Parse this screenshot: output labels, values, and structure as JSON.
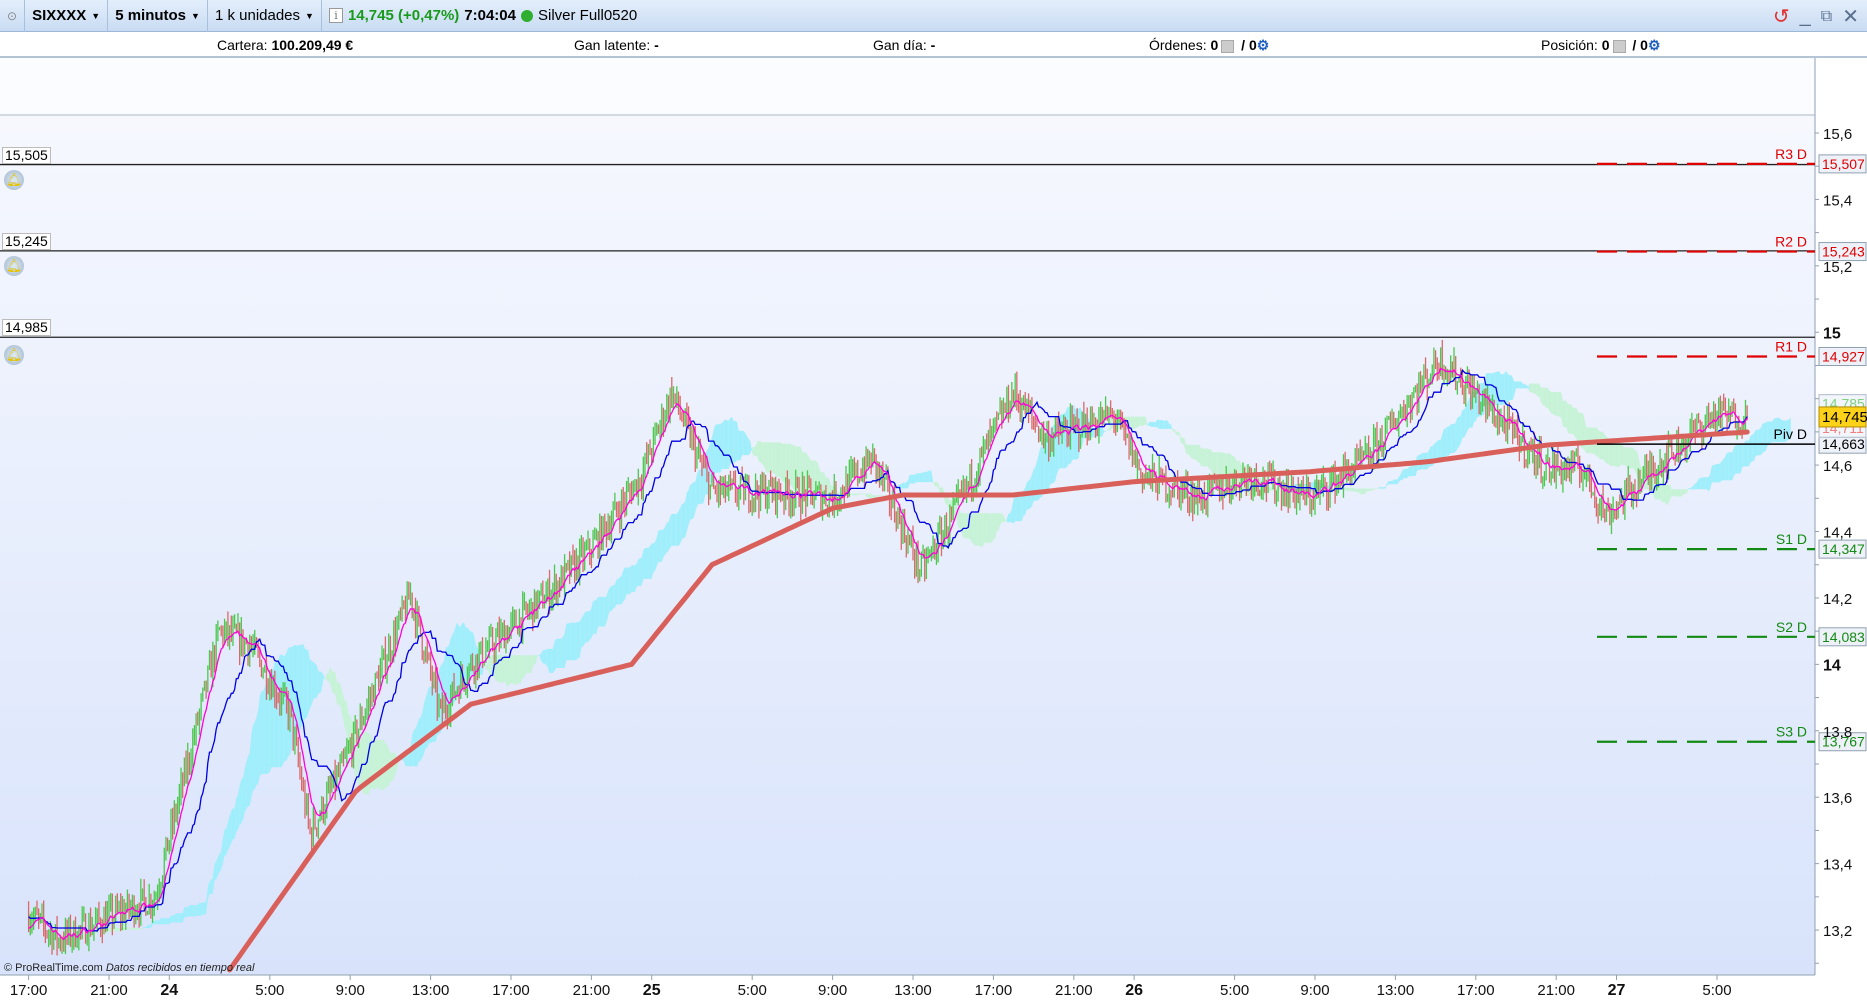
{
  "toolbar": {
    "instrument": "SIXXXX",
    "timeframe": "5 minutos",
    "units": "1 k unidades",
    "price": "14,745 (+0,47%)",
    "time": "7:04:04",
    "status_color": "#2fae2f",
    "feed": "Silver Full0520"
  },
  "infobar": {
    "cartera_label": "Cartera:",
    "cartera_value": "100.209,49 €",
    "gan_latente_label": "Gan latente:",
    "gan_latente_value": "-",
    "gan_dia_label": "Gan día:",
    "gan_dia_value": "-",
    "ordenes_label": "Órdenes:",
    "ordenes_a": "0",
    "ordenes_b": "/ 0",
    "posicion_label": "Posición:",
    "posicion_a": "0",
    "posicion_b": "/ 0"
  },
  "alerts": [
    {
      "label": "15,505",
      "value": 15.505
    },
    {
      "label": "15,245",
      "value": 15.245
    },
    {
      "label": "14,985",
      "value": 14.985
    }
  ],
  "credit": {
    "brand": "© ProRealTime.com",
    "text": "Datos recibidos en tiempo real"
  },
  "chart_data": {
    "type": "candlestick",
    "ylim": [
      13.1,
      15.7
    ],
    "y_ticks": [
      {
        "v": 15.6,
        "t": "15,6"
      },
      {
        "v": 15.4,
        "t": "15,4"
      },
      {
        "v": 15.2,
        "t": "15,2"
      },
      {
        "v": 15,
        "t": "15",
        "bold": true
      },
      {
        "v": 14.8,
        "t": ""
      },
      {
        "v": 14.6,
        "t": "14,6"
      },
      {
        "v": 14.4,
        "t": "14,4"
      },
      {
        "v": 14.2,
        "t": "14,2"
      },
      {
        "v": 14,
        "t": "14",
        "bold": true
      },
      {
        "v": 13.8,
        "t": "13,8"
      },
      {
        "v": 13.6,
        "t": "13,6"
      },
      {
        "v": 13.4,
        "t": "13,4"
      },
      {
        "v": 13.2,
        "t": "13,2"
      }
    ],
    "x_ticks": [
      {
        "h": 0,
        "t": "17:00"
      },
      {
        "h": 4,
        "t": "21:00"
      },
      {
        "h": 7,
        "t": "24",
        "bold": true
      },
      {
        "h": 12,
        "t": "5:00"
      },
      {
        "h": 16,
        "t": "9:00"
      },
      {
        "h": 20,
        "t": "13:00"
      },
      {
        "h": 24,
        "t": "17:00"
      },
      {
        "h": 28,
        "t": "21:00"
      },
      {
        "h": 31,
        "t": "25",
        "bold": true
      },
      {
        "h": 36,
        "t": "5:00"
      },
      {
        "h": 40,
        "t": "9:00"
      },
      {
        "h": 44,
        "t": "13:00"
      },
      {
        "h": 48,
        "t": "17:00"
      },
      {
        "h": 52,
        "t": "21:00"
      },
      {
        "h": 55,
        "t": "26",
        "bold": true
      },
      {
        "h": 60,
        "t": "5:00"
      },
      {
        "h": 64,
        "t": "9:00"
      },
      {
        "h": 68,
        "t": "13:00"
      },
      {
        "h": 72,
        "t": "17:00"
      },
      {
        "h": 76,
        "t": "21:00"
      },
      {
        "h": 79,
        "t": "27",
        "bold": true
      },
      {
        "h": 84,
        "t": "5:00"
      }
    ],
    "price_path_hours": [
      0,
      1.5,
      6.3,
      9.5,
      11,
      13,
      14,
      15.7,
      19,
      20.5,
      22,
      25.8,
      28,
      30.5,
      32,
      34,
      37,
      40,
      42,
      44.4,
      46,
      49,
      50.6,
      54,
      55.4,
      58.3,
      60.7,
      63.7,
      66.6,
      70.2,
      72.5,
      75.5,
      77.3,
      78.5,
      80.8,
      83.8,
      85.6
    ],
    "price_path": [
      13.25,
      13.17,
      13.3,
      14.1,
      14.06,
      13.85,
      13.49,
      13.7,
      14.21,
      13.85,
      14.0,
      14.21,
      14.35,
      14.57,
      14.82,
      14.52,
      14.52,
      14.5,
      14.62,
      14.28,
      14.45,
      14.82,
      14.68,
      14.75,
      14.57,
      14.5,
      14.57,
      14.5,
      14.62,
      14.92,
      14.78,
      14.59,
      14.59,
      14.45,
      14.59,
      14.75,
      14.745
    ],
    "moving_average_hours": [
      10,
      16.3,
      22,
      30,
      34,
      40,
      43.5,
      49,
      55,
      63.7,
      69.6,
      75.5,
      85.6
    ],
    "moving_average": [
      13.08,
      13.62,
      13.88,
      14.0,
      14.3,
      14.47,
      14.51,
      14.51,
      14.55,
      14.58,
      14.61,
      14.66,
      14.7
    ],
    "pivots": [
      {
        "name": "R3 D",
        "value": 15.507,
        "label": "15,507",
        "color": "#e00000",
        "dashed": true
      },
      {
        "name": "R2 D",
        "value": 15.243,
        "label": "15,243",
        "color": "#e00000",
        "dashed": true
      },
      {
        "name": "R1 D",
        "value": 14.927,
        "label": "14,927",
        "color": "#e00000",
        "dashed": true
      },
      {
        "name": "Piv D",
        "value": 14.663,
        "label": "14,663",
        "color": "#000000",
        "dashed": false
      },
      {
        "name": "S1 D",
        "value": 14.347,
        "label": "14,347",
        "color": "#138a13",
        "dashed": true
      },
      {
        "name": "S2 D",
        "value": 14.083,
        "label": "14,083",
        "color": "#138a13",
        "dashed": true
      },
      {
        "name": "S3 D",
        "value": 13.767,
        "label": "13,767",
        "color": "#138a13",
        "dashed": true
      }
    ],
    "last_price": {
      "value": 14.745,
      "label": "14,745",
      "color": "#ffd21a"
    },
    "hidden_labels": [
      {
        "value": 14.785,
        "label": "14,785",
        "color": "#7fd07f"
      },
      {
        "value": 14.711,
        "label": "14,711",
        "color": "#f08080"
      }
    ],
    "colors": {
      "up": "#4cc84c",
      "down": "#d86a6a",
      "ma": "#d9605a",
      "kijun": "#0000e0",
      "tenkan": "#ff00dd",
      "cloud_up": "#9eeefc",
      "cloud_down": "#c6f3d6"
    }
  }
}
